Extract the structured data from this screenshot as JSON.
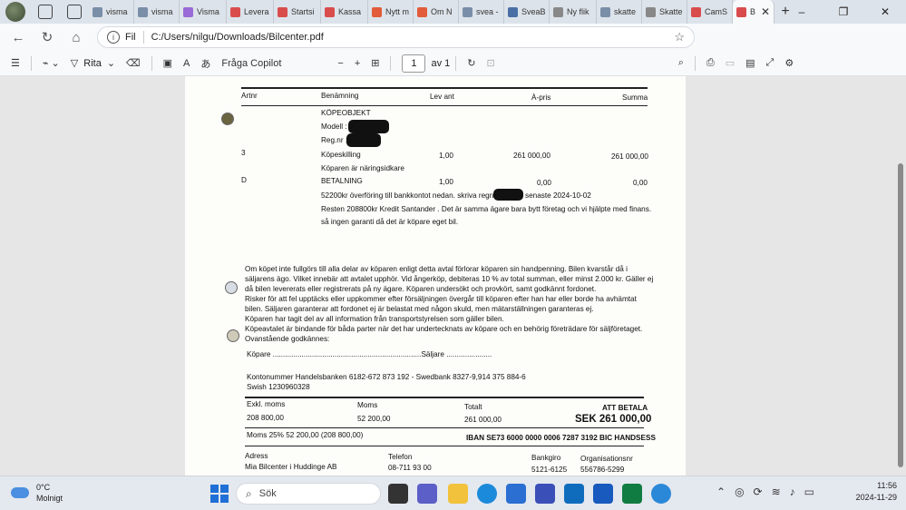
{
  "tabs": [
    {
      "label": "visma",
      "color": "#7a8ea8"
    },
    {
      "label": "visma",
      "color": "#7a8ea8"
    },
    {
      "label": "Visma",
      "color": "#9a6ad6"
    },
    {
      "label": "Levera",
      "color": "#d94c4c"
    },
    {
      "label": "Startsi",
      "color": "#d94c4c"
    },
    {
      "label": "Kassa",
      "color": "#d94c4c"
    },
    {
      "label": "Nytt m",
      "color": "#e25b3a"
    },
    {
      "label": "Om N",
      "color": "#e25b3a"
    },
    {
      "label": "svea -",
      "color": "#7a8ea8"
    },
    {
      "label": "SveaB",
      "color": "#4a6fa5"
    },
    {
      "label": "Ny flik",
      "color": "#888888"
    },
    {
      "label": "skatte",
      "color": "#7a8ea8"
    },
    {
      "label": "Skatte",
      "color": "#888888"
    },
    {
      "label": "CamS",
      "color": "#d94c4c"
    },
    {
      "label": "B",
      "color": "#d94c4c",
      "active": true
    }
  ],
  "address": {
    "scheme": "Fil",
    "url": "C:/Users/nilgu/Downloads/Bilcenter.pdf"
  },
  "pdf_toolbar": {
    "draw": "Rita",
    "copilot": "Fråga Copilot",
    "page": "1",
    "of_pages": "av 1"
  },
  "invoice": {
    "headers": {
      "artnr": "Artnr",
      "name": "Benämning",
      "qty": "Lev ant",
      "unit_price": "À-pris",
      "sum": "Summa"
    },
    "object_heading": "KÖPEOBJEKT",
    "model_label": "Modell :",
    "regnr_label": "Reg.nr :",
    "row1": {
      "artnr": "3",
      "name": "Köpeskilling",
      "qty": "1,00",
      "price": "261 000,00",
      "sum": "261 000,00"
    },
    "row1_note": "Köparen är näringsidkare",
    "row2": {
      "artnr": "D",
      "name": "BETALNING",
      "qty": "1,00",
      "price": "0,00",
      "sum": "0,00"
    },
    "payment_line1a": "52200kr överföring till bankkontot nedan. skriva regnr",
    "payment_line1b": "senaste 2024-10-02",
    "payment_line2": "Resten 208800kr Kredit Santander . Det är samma ägare bara bytt företag och vi hjälpte med finans.",
    "payment_line3": "så ingen garanti då det är köpare eget bil.",
    "terms": [
      "Om köpet inte fullgörs till alla delar av köparen enligt detta avtal förlorar köparen sin handpenning. Bilen kvarstår då i",
      "säljarens ägo. Vilket innebär att avtalet upphör. Vid ångerköp, debiteras 10 % av total summan, eller minst 2.000 kr. Gäller ej",
      "då bilen levererats eller registrerats på ny ägare. Köparen undersökt och provkört, samt godkännt fordonet.",
      "Risker för att fel upptäcks eller uppkommer efter försäljningen övergår till köparen efter han har eller borde ha avhämtat",
      "bilen. Säljaren garanterar att fordonet ej är belastat med någon skuld, men mätarställningen garanteras ej.",
      "Köparen har tagit del av all information från transportstyrelsen som gäller bilen.",
      "Köpeavtalet är bindande för båda parter när det har undertecknats av köpare och en behörig företrädare för säljföretaget.",
      "Ovanstående godkännes:"
    ],
    "buyer_line": "Köpare ........................................................................Säljare ......................",
    "accounts": "Kontonummer Handelsbanken 6182-672 873 192 - Swedbank 8327-9,914 375 884-6",
    "swish": "Swish 1230960328",
    "totals": {
      "excl_label": "Exkl. moms",
      "excl_value": "208 800,00",
      "vat_label": "Moms",
      "vat_value": "52 200,00",
      "total_label": "Totalt",
      "total_value": "261 000,00",
      "pay_label": "ATT BETALA",
      "pay_value": "SEK 261 000,00"
    },
    "vat_note": "Moms 25% 52 200,00 (208 800,00)",
    "iban": "IBAN SE73 6000 0000 0006 7287 3192  BIC HANDSESS",
    "footer": {
      "address_label": "Adress",
      "address_value": "Mia Bilcenter i Huddinge AB",
      "phone_label": "Telefon",
      "phone_value": "08-711 93 00",
      "bankgiro_label": "Bankgiro",
      "bankgiro_value": "5121-6125",
      "org_label": "Organisationsnr",
      "org_value": "556786-5299"
    }
  },
  "taskbar": {
    "weather_temp": "0°C",
    "weather_desc": "Molnigt",
    "search_placeholder": "Sök",
    "time": "11:56",
    "date": "2024-11-29"
  }
}
